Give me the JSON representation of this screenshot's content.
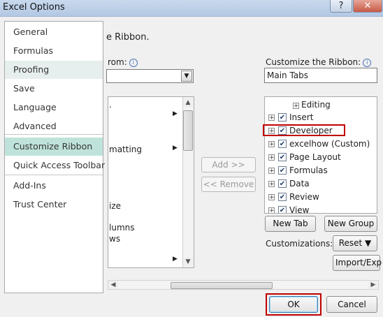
{
  "window": {
    "title": "Excel Options",
    "help_label": "?",
    "close_label": "✕"
  },
  "sidebar": {
    "items": [
      {
        "label": "General"
      },
      {
        "label": "Formulas"
      },
      {
        "label": "Proofing"
      },
      {
        "label": "Save"
      },
      {
        "label": "Language"
      },
      {
        "label": "Advanced"
      },
      {
        "label": "Customize Ribbon",
        "selected": true
      },
      {
        "label": "Quick Access Toolbar"
      },
      {
        "label": "Add-Ins"
      },
      {
        "label": "Trust Center"
      }
    ]
  },
  "main": {
    "heading_fragment": "e Ribbon.",
    "choose_label_fragment": "rom:",
    "left_list_items": [
      ".",
      "matting",
      "ize",
      "lumns",
      "ws"
    ],
    "add_button": "Add >>",
    "remove_button": "<< Remove"
  },
  "ribbon": {
    "label": "Customize the Ribbon:",
    "selected_value": "Main Tabs",
    "editing_label": "Editing",
    "tabs": [
      {
        "label": "Insert",
        "checked": true
      },
      {
        "label": "Developer",
        "checked": true,
        "highlighted": true
      },
      {
        "label": "excelhow (Custom)",
        "checked": true
      },
      {
        "label": "Page Layout",
        "checked": true
      },
      {
        "label": "Formulas",
        "checked": true
      },
      {
        "label": "Data",
        "checked": true
      },
      {
        "label": "Review",
        "checked": true
      },
      {
        "label": "View",
        "checked": true
      }
    ],
    "new_tab_button": "New Tab",
    "new_group_button": "New Group",
    "customizations_label": "Customizations:",
    "reset_button": "Reset ▼",
    "import_export_button": "Import/Exp"
  },
  "footer": {
    "ok_button": "OK",
    "cancel_button": "Cancel"
  },
  "colors": {
    "selected_nav": "#bfe3da",
    "highlight_box": "#c00000"
  }
}
